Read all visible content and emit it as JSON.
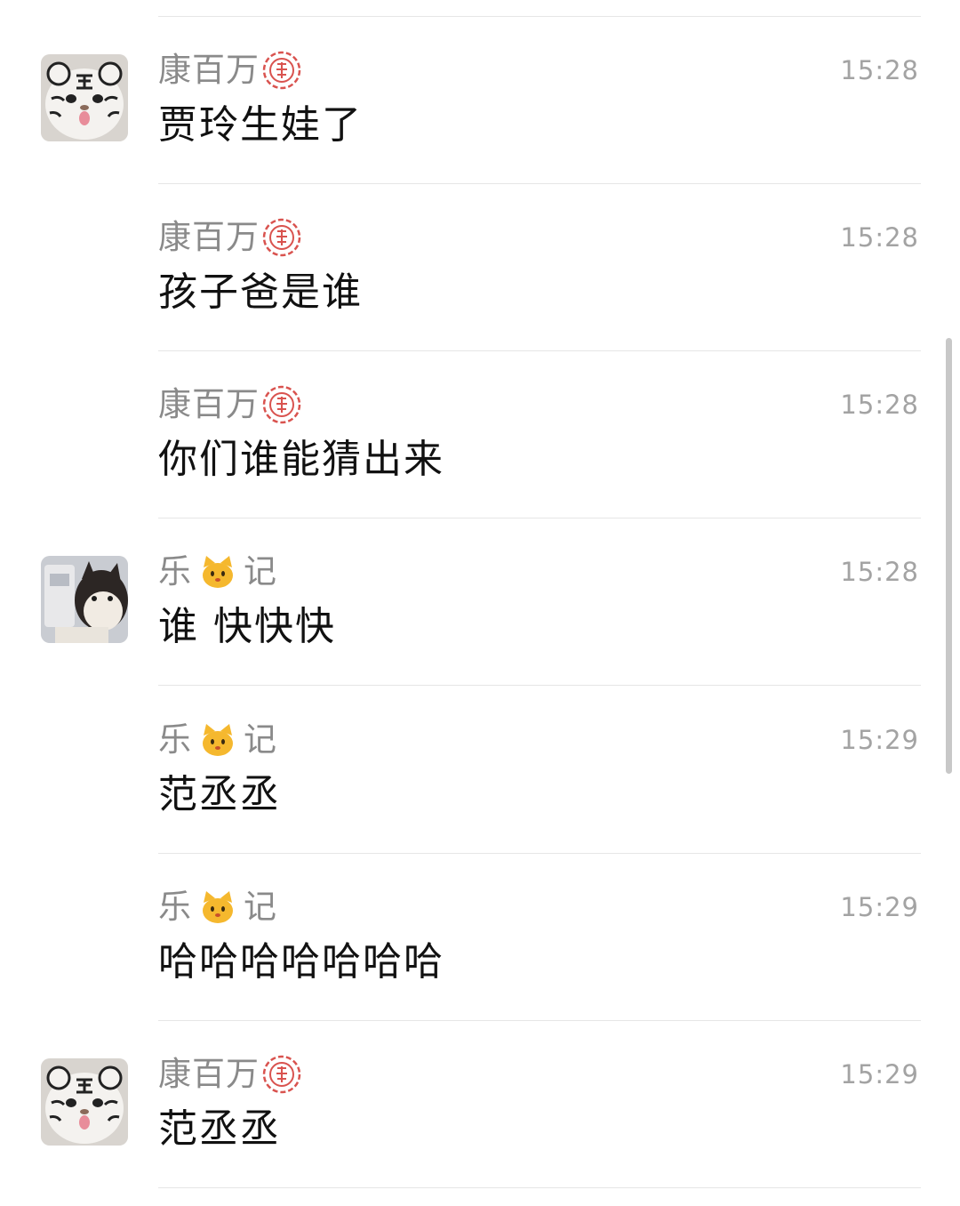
{
  "messages": [
    {
      "sender": "康百万",
      "badge": "seal-icon",
      "time": "15:28",
      "text": "贾玲生娃了",
      "avatar": "tiger-avatar"
    },
    {
      "sender": "康百万",
      "badge": "seal-icon",
      "time": "15:28",
      "text": "孩子爸是谁",
      "avatar": ""
    },
    {
      "sender": "康百万",
      "badge": "seal-icon",
      "time": "15:28",
      "text": "你们谁能猜出来",
      "avatar": ""
    },
    {
      "sender_a": "乐",
      "sender_b": "记",
      "badge": "cat-emoji",
      "time": "15:28",
      "text": "谁 快快快",
      "avatar": "cat-avatar"
    },
    {
      "sender_a": "乐",
      "sender_b": "记",
      "badge": "cat-emoji",
      "time": "15:29",
      "text": "范丞丞",
      "avatar": ""
    },
    {
      "sender_a": "乐",
      "sender_b": "记",
      "badge": "cat-emoji",
      "time": "15:29",
      "text": "哈哈哈哈哈哈哈",
      "avatar": ""
    },
    {
      "sender": "康百万",
      "badge": "seal-icon",
      "time": "15:29",
      "text": "范丞丞",
      "avatar": "tiger-avatar"
    }
  ],
  "colors": {
    "sender": "#8a8a8a",
    "time": "#a3a3a3",
    "text": "#111111",
    "divider": "#e6e6e6",
    "seal": "#d9534f",
    "cat": "#f5b82e"
  }
}
